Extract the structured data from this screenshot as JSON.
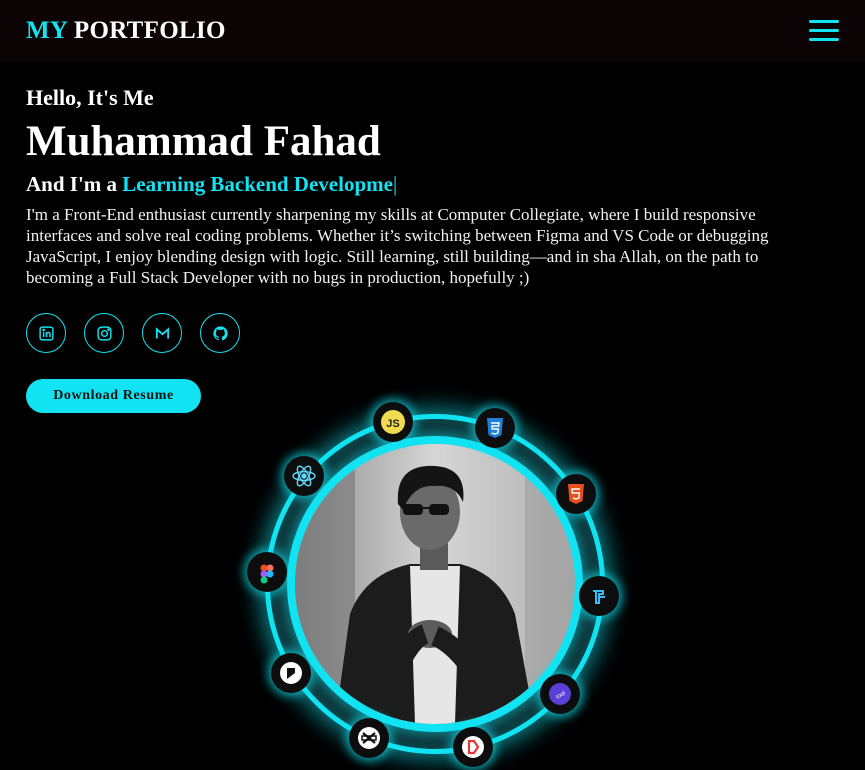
{
  "nav": {
    "logo_accent": "MY",
    "logo_rest": "PORTFOLIO",
    "menu_icon": "hamburger-menu-icon"
  },
  "hero": {
    "greeting": "Hello, It's Me",
    "name": "Muhammad Fahad",
    "role_prefix": "And I'm a",
    "role_typed": "Learning Backend Developme",
    "cursor": "|",
    "bio": "I'm a Front-End enthusiast currently sharpening my skills at Computer Collegiate, where I build responsive interfaces and solve real coding problems. Whether it’s switching between Figma and VS Code or debugging JavaScript, I enjoy blending design with logic. Still learning, still building—and in sha Allah, on the path to becoming a Full Stack Developer with no bugs in production, hopefully ;)",
    "download_label": "Download Resume"
  },
  "socials": [
    {
      "icon": "linkedin-icon"
    },
    {
      "icon": "instagram-icon"
    },
    {
      "icon": "gmail-icon"
    },
    {
      "icon": "github-icon"
    }
  ],
  "tech_icons": [
    {
      "icon": "javascript-icon",
      "label": "JS"
    },
    {
      "icon": "css3-icon"
    },
    {
      "icon": "html5-icon"
    },
    {
      "icon": "tailwind-icon"
    },
    {
      "icon": "bootstrap-icon"
    },
    {
      "icon": "dart-icon"
    },
    {
      "icon": "capcut-icon"
    },
    {
      "icon": "framer-icon"
    },
    {
      "icon": "figma-icon"
    },
    {
      "icon": "react-icon"
    }
  ],
  "colors": {
    "accent": "#12e3f2",
    "background": "#000000",
    "navbar": "#0c0404"
  }
}
